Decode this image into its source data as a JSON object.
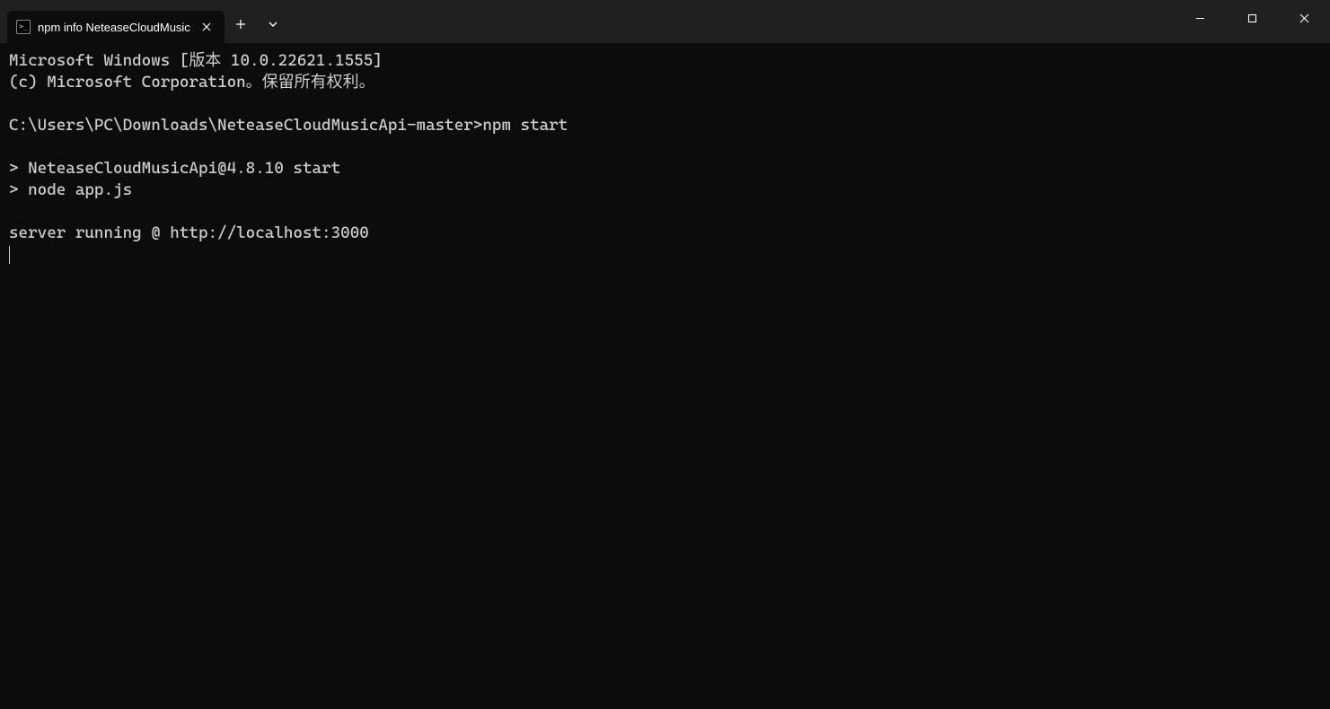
{
  "tab": {
    "title": "npm info NeteaseCloudMusic"
  },
  "terminal": {
    "lines": [
      "Microsoft Windows [版本 10.0.22621.1555]",
      "(c) Microsoft Corporation。保留所有权利。",
      "",
      "C:\\Users\\PC\\Downloads\\NeteaseCloudMusicApi-master>npm start",
      "",
      "> NeteaseCloudMusicApi@4.8.10 start",
      "> node app.js",
      "",
      "server running @ http://localhost:3000"
    ]
  }
}
